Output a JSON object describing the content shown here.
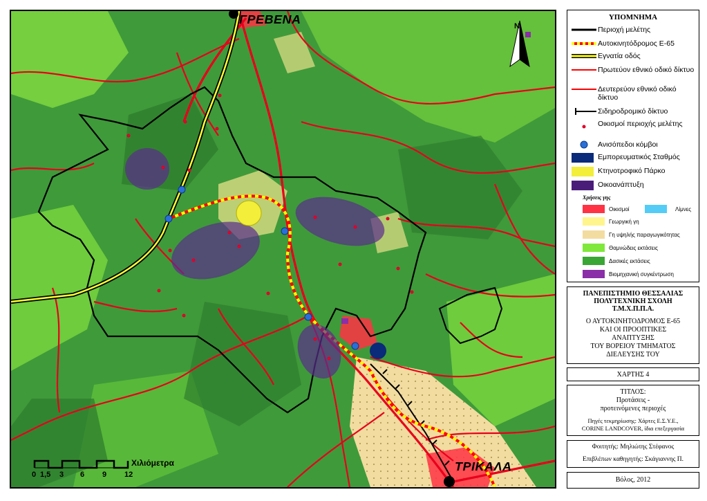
{
  "map": {
    "cities": {
      "north": "ΓΡΕΒΕΝΑ",
      "south": "ΤΡΙΚΑΛΑ"
    },
    "north_arrow_label": "N",
    "scale": {
      "ticks": [
        "0",
        "1,5",
        "3",
        "6",
        "9",
        "12"
      ],
      "unit": "Χιλιόμετρα"
    }
  },
  "legend": {
    "title": "ΥΠΟΜΝΗΜΑ",
    "items": [
      {
        "label": "Περιοχή μελέτης",
        "symbol": "black-line",
        "color": "#000000"
      },
      {
        "label": "Αυτοκινητόδρομος Ε-65",
        "symbol": "red-yellow-dashed-line",
        "color": "#ff0000"
      },
      {
        "label": "Εγνατία οδός",
        "symbol": "black-yellow-line",
        "color": "#ffff00"
      },
      {
        "label": "Πρωτεύον εθνικό οδικό δίκτυο",
        "symbol": "red-line",
        "color": "#ff0000"
      },
      {
        "label": "Δευτερεύον εθνικό οδικό δίκτυο",
        "symbol": "red-line",
        "color": "#ff0000"
      },
      {
        "label": "Σιδηροδρομικό δίκτυο",
        "symbol": "railway",
        "color": "#000000"
      },
      {
        "label": "Οικισμοί περιοχής μελέτης",
        "symbol": "red-dot",
        "color": "#e0002a"
      },
      {
        "label": "Ανισόπεδοι κόμβοι",
        "symbol": "blue-dot",
        "color": "#2a6fd6"
      },
      {
        "label": "Εμπορευματικός Σταθμός",
        "symbol": "navy-box",
        "color": "#0a2a7a"
      },
      {
        "label": "Κτηνοτροφικό Πάρκο",
        "symbol": "yellow-box",
        "color": "#f2ee3a"
      },
      {
        "label": "Οικοανάπτυξη",
        "symbol": "purple-box",
        "color": "#4a1c7a"
      }
    ],
    "land_use_title": "Χρήσεις γης",
    "land_use": [
      {
        "label": "Οικισμοί",
        "color": "#ff3344"
      },
      {
        "label": "Λίμνες",
        "color": "#55ccf5"
      },
      {
        "label": "Γεωργική γη",
        "color": "#fff58c"
      },
      {
        "label": "Γη υψηλής παραγωγικότητας",
        "color": "#f2dca0"
      },
      {
        "label": "Θαμνώδεις εκτάσεις",
        "color": "#7fe83a"
      },
      {
        "label": "Δασικές εκτάσεις",
        "color": "#3aa635"
      },
      {
        "label": "Βιομηχανική συγκέντρωση",
        "color": "#8a2fa8"
      }
    ]
  },
  "info": {
    "institution": [
      "ΠΑΝΕΠΙΣΤΗΜΙΟ ΘΕΣΣΑΛΙΑΣ",
      "ΠΟΛΥΤΕΧΝΙΚΗ ΣΧΟΛΗ",
      "Τ.Μ.Χ.Π.Π.Α."
    ],
    "project": [
      "Ο ΑΥΤΟΚΙΝΗΤΟΔΡΟΜΟΣ Ε-65",
      "ΚΑΙ ΟΙ ΠΡΟΟΠΤΙΚΕΣ",
      "ΑΝΑΠΤΥΞΗΣ",
      "ΤΟΥ ΒΟΡΕΙΟΥ ΤΜΗΜΑΤΟΣ",
      "ΔΙΕΛΕΥΣΗΣ ΤΟΥ"
    ],
    "map_number": "ΧΑΡΤΗΣ 4",
    "title_label": "ΤΙΤΛΟΣ:",
    "title_lines": [
      "Προτάσεις -",
      "προτεινόμενες περιοχές"
    ],
    "sources": [
      "Πηγές τεκμηρίωσης: Χάρτες Ε.Σ.Υ.Ε.,",
      "CORINE LANDCOVER, ίδια επεξεργασία"
    ],
    "student": "Φοιτητής: Μηλιώτης Στέφανος",
    "supervisor": "Επιβλέπων καθηγητής: Σκάγιαννης Π.",
    "place_date": "Βόλος, 2012"
  }
}
